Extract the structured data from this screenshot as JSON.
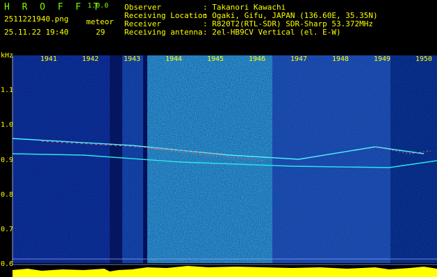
{
  "header": {
    "app_name": "H R O F F T",
    "version": "1.0.0",
    "file_name": "2511221940.png",
    "datetime": "25.11.22 19:40",
    "meteor_label": "meteor",
    "meteor_count": "29",
    "fields": [
      {
        "label": "Observer",
        "value": ": Takanori Kawachi"
      },
      {
        "label": "Receiving Location",
        "value": ": Ogaki, Gifu, JAPAN (136.60E, 35.35N)"
      },
      {
        "label": "Receiver",
        "value": ": R820T2(RTL-SDR) SDR-Sharp 53.372MHz"
      },
      {
        "label": "Receiving antenna",
        "value": ": 2el-HB9CV Vertical (el. E-W)"
      }
    ]
  },
  "spectrogram": {
    "unit": "kHz",
    "y_labels": [
      "1.1",
      "1.0",
      "0.9",
      "0.8",
      "0.7",
      "0.6"
    ],
    "minute_labels": [
      "1941",
      "1942",
      "1943",
      "1944",
      "1945",
      "1946",
      "1947",
      "1948",
      "1949",
      "1950"
    ]
  },
  "colors": {
    "background": "#0a0a6e",
    "text_primary": "#ffff00",
    "brand": "#7CFC00",
    "noise_floor": "#ffff00"
  }
}
